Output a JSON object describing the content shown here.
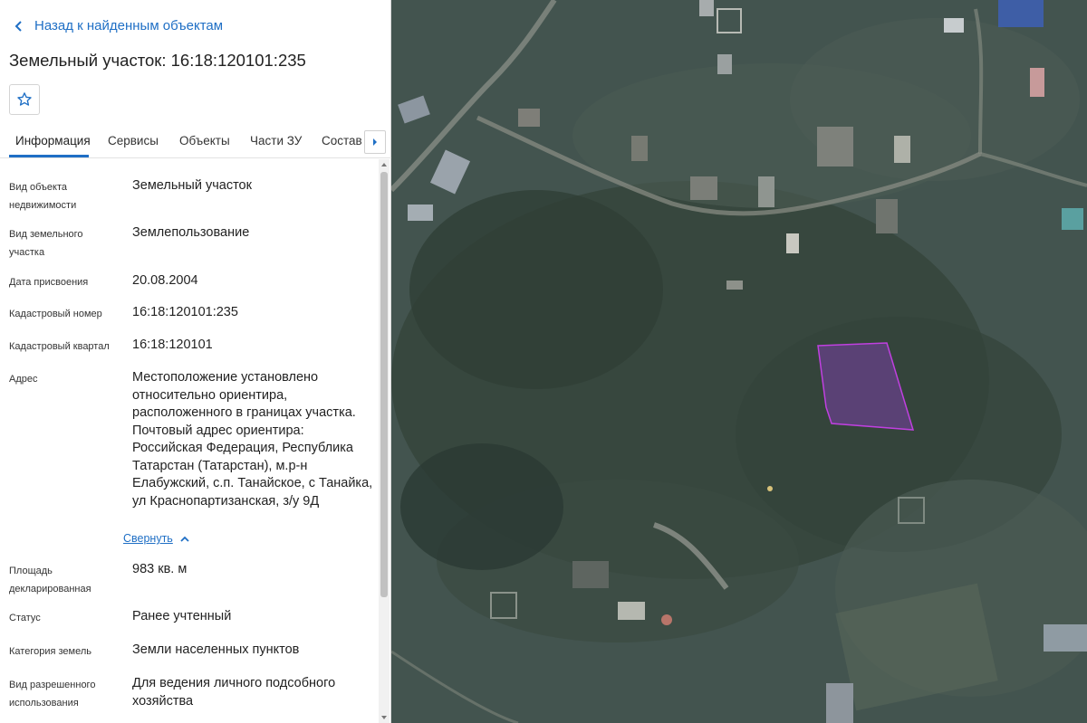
{
  "header": {
    "back_label": "Назад к найденным объектам",
    "title": "Земельный участок: 16:18:120101:235"
  },
  "tabs": [
    "Информация",
    "Сервисы",
    "Объекты",
    "Части ЗУ",
    "Состав"
  ],
  "info": {
    "rows": [
      {
        "label": "Вид объекта недвижимости",
        "value": "Земельный участок"
      },
      {
        "label": "Вид земельного участка",
        "value": "Землепользование"
      },
      {
        "label": "Дата присвоения",
        "value": "20.08.2004"
      },
      {
        "label": "Кадастровый номер",
        "value": "16:18:120101:235"
      },
      {
        "label": "Кадастровый квартал",
        "value": "16:18:120101"
      },
      {
        "label": "Адрес",
        "value": "Местоположение установлено относительно ориентира, расположенного в границах участка. Почтовый адрес ориентира: Российская Федерация, Республика Татарстан (Татарстан), м.р-н Елабужский, с.п. Танайское, с Танайка, ул Краснопартизанская, з/у 9Д"
      },
      {
        "label": "Площадь декларированная",
        "value": "983 кв. м"
      },
      {
        "label": "Статус",
        "value": "Ранее учтенный"
      },
      {
        "label": "Категория земель",
        "value": "Земли населенных пунктов"
      },
      {
        "label": "Вид разрешенного использования",
        "value": "Для ведения личного подсобного хозяйства"
      }
    ],
    "collapse_label": "Свернуть"
  },
  "colors": {
    "accent": "#1f6fc5",
    "parcel_fill": "#7a3fa6",
    "parcel_stroke": "#c040e0"
  },
  "icons": [
    "chevron-left-icon",
    "star-icon",
    "chevron-right-icon",
    "chevron-up-icon"
  ]
}
